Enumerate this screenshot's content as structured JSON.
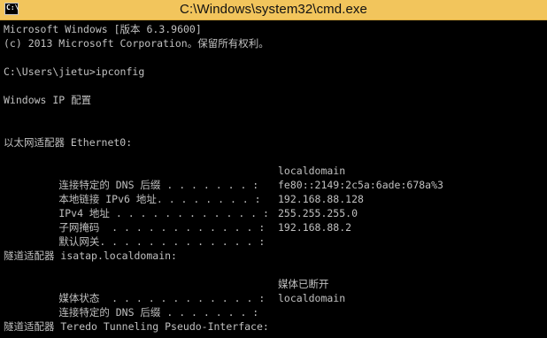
{
  "window": {
    "title": "C:\\Windows\\system32\\cmd.exe",
    "icon_text": "C:\\",
    "icon": "cmd-icon"
  },
  "console": {
    "lines": [
      {
        "text": "Microsoft Windows [版本 6.3.9600]"
      },
      {
        "text": "(c) 2013 Microsoft Corporation。保留所有权利。"
      },
      {
        "text": "C:\\Users\\jietu>ipconfig"
      },
      {
        "text": "Windows IP 配置"
      },
      {
        "text": "以太网适配器 Ethernet0:"
      },
      {
        "label": "   连接特定的 DNS 后缀 . . . . . . . :",
        "value": "localdomain"
      },
      {
        "label": "   本地链接 IPv6 地址. . . . . . . . :",
        "value": "fe80::2149:2c5a:6ade:678a%3"
      },
      {
        "label": "   IPv4 地址 . . . . . . . . . . . . :",
        "value": "192.168.88.128"
      },
      {
        "label": "   子网掩码  . . . . . . . . . . . . :",
        "value": "255.255.255.0"
      },
      {
        "label": "   默认网关. . . . . . . . . . . . . :",
        "value": "192.168.88.2"
      },
      {
        "text": "隧道适配器 isatap.localdomain:"
      },
      {
        "label": "   媒体状态  . . . . . . . . . . . . :",
        "value": "媒体已断开"
      },
      {
        "label": "   连接特定的 DNS 后缀 . . . . . . . :",
        "value": "localdomain"
      },
      {
        "text": "隧道适配器 Teredo Tunneling Pseudo-Interface:"
      }
    ]
  },
  "colors": {
    "titlebar": "#f2c55c",
    "console_bg": "#000000",
    "console_text": "#c0c0c0"
  }
}
